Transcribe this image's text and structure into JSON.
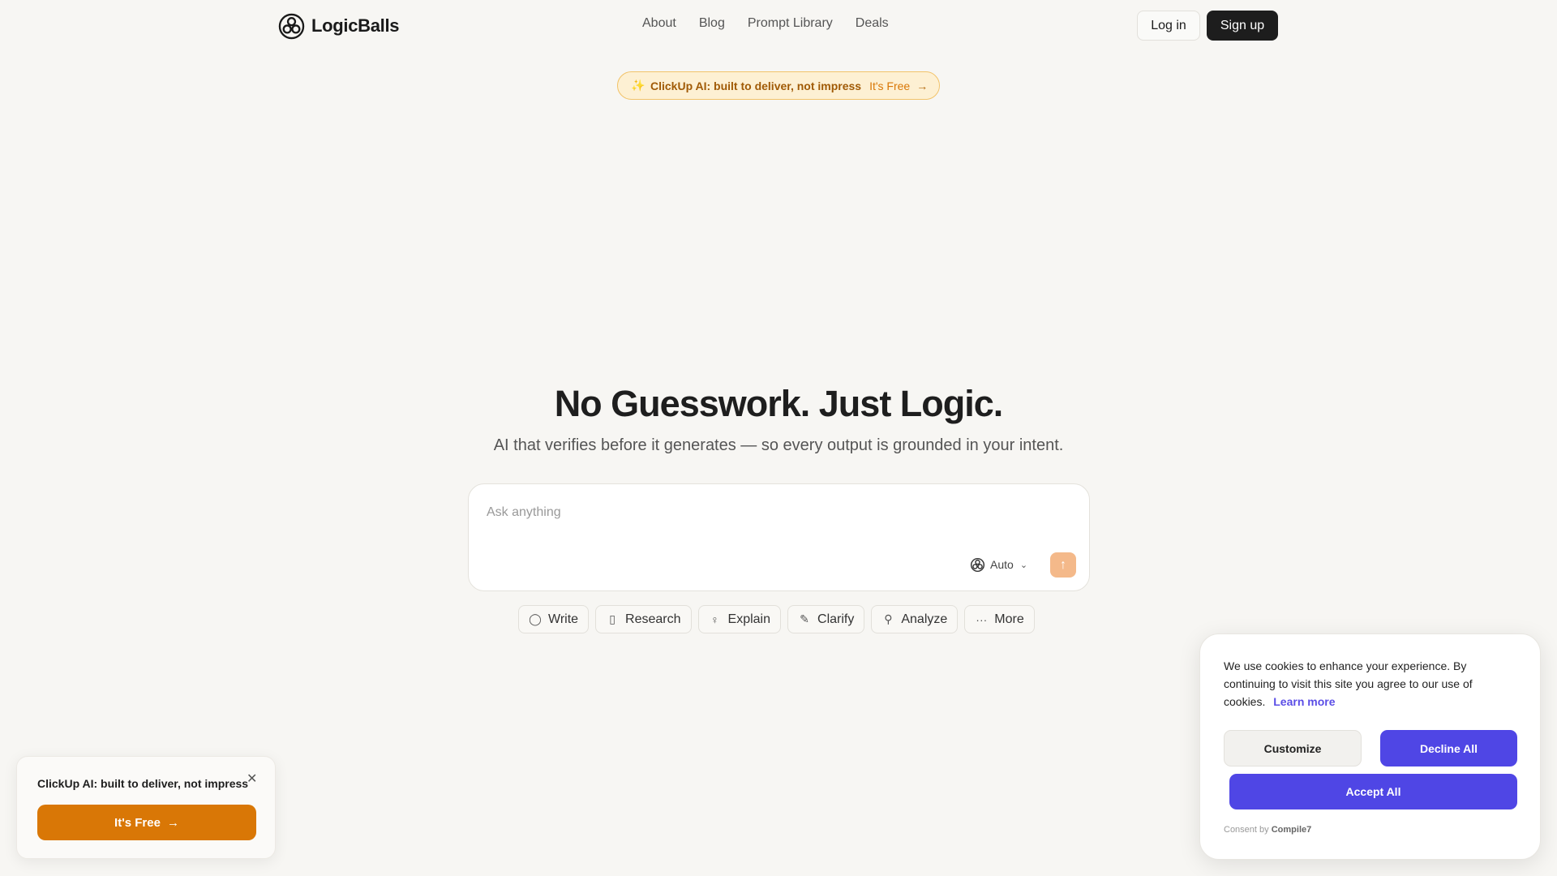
{
  "header": {
    "logo_text": "LogicBalls",
    "nav": [
      {
        "label": "About"
      },
      {
        "label": "Blog"
      },
      {
        "label": "Prompt Library"
      },
      {
        "label": "Deals"
      }
    ],
    "login_label": "Log in",
    "signup_label": "Sign up"
  },
  "promo_banner": {
    "icon": "sparkle-icon",
    "title": "ClickUp AI: built to deliver, not impress",
    "cta": "It's Free"
  },
  "hero": {
    "title": "No Guesswork. Just Logic.",
    "subtitle": "AI that verifies before it generates — so every output is grounded in your intent."
  },
  "prompt": {
    "placeholder": "Ask anything",
    "value": "",
    "model": "Auto"
  },
  "actions": [
    {
      "label": "Write",
      "icon": "chat-bubble-icon"
    },
    {
      "label": "Research",
      "icon": "book-icon"
    },
    {
      "label": "Explain",
      "icon": "lightbulb-icon"
    },
    {
      "label": "Clarify",
      "icon": "pencil-icon"
    },
    {
      "label": "Analyze",
      "icon": "analyze-icon"
    },
    {
      "label": "More",
      "icon": "ellipsis-icon"
    }
  ],
  "promo_card": {
    "title": "ClickUp AI: built to deliver, not impress",
    "cta": "It's Free"
  },
  "cookie": {
    "text": "We use cookies to enhance your experience. By continuing to visit this site you agree to our use of cookies.",
    "learn_more": "Learn more",
    "customize": "Customize",
    "decline": "Decline All",
    "accept": "Accept All",
    "consent_prefix": "Consent by",
    "consent_brand": "Compile7"
  },
  "colors": {
    "background": "#f7f6f3",
    "accent_orange": "#d97706",
    "accent_indigo": "#4f46e5",
    "dark_button": "#1d1d1d"
  }
}
